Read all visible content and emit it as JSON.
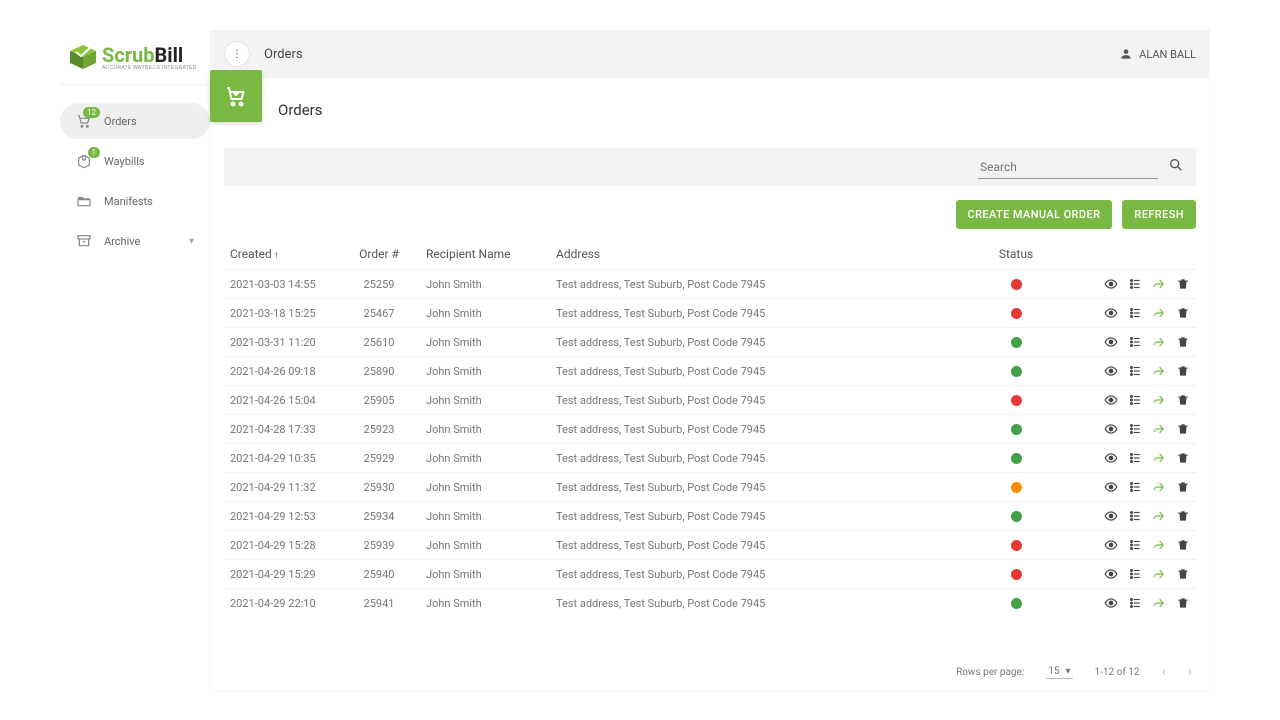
{
  "brand": {
    "name_a": "Scrub",
    "name_b": "Bill",
    "tagline": "ACCURATE WAYBILLS INTEGRATED"
  },
  "user": {
    "name": "ALAN BALL"
  },
  "crumb": "Orders",
  "nav": {
    "items": [
      {
        "label": "Orders",
        "badge": "12",
        "active": true
      },
      {
        "label": "Waybills",
        "badge": "1",
        "active": false
      },
      {
        "label": "Manifests",
        "badge": "",
        "active": false
      },
      {
        "label": "Archive",
        "badge": "",
        "active": false,
        "expandable": true
      }
    ]
  },
  "page": {
    "title": "Orders"
  },
  "search": {
    "placeholder": "Search"
  },
  "buttons": {
    "create": "CREATE MANUAL ORDER",
    "refresh": "REFRESH"
  },
  "columns": {
    "created": "Created",
    "order": "Order #",
    "recipient": "Recipient Name",
    "address": "Address",
    "status": "Status"
  },
  "rows": [
    {
      "created": "2021-03-03 14:55",
      "order": "25259",
      "name": "John Smith",
      "addr": "Test address, Test Suburb, Post Code 7945",
      "status": "red"
    },
    {
      "created": "2021-03-18 15:25",
      "order": "25467",
      "name": "John Smith",
      "addr": "Test address, Test Suburb, Post Code 7945",
      "status": "red"
    },
    {
      "created": "2021-03-31 11:20",
      "order": "25610",
      "name": "John Smith",
      "addr": "Test address, Test Suburb, Post Code 7945",
      "status": "green"
    },
    {
      "created": "2021-04-26 09:18",
      "order": "25890",
      "name": "John Smith",
      "addr": "Test address, Test Suburb, Post Code 7945",
      "status": "green"
    },
    {
      "created": "2021-04-26 15:04",
      "order": "25905",
      "name": "John Smith",
      "addr": "Test address, Test Suburb, Post Code 7945",
      "status": "red"
    },
    {
      "created": "2021-04-28 17:33",
      "order": "25923",
      "name": "John Smith",
      "addr": "Test address, Test Suburb, Post Code 7945",
      "status": "green"
    },
    {
      "created": "2021-04-29 10:35",
      "order": "25929",
      "name": "John Smith",
      "addr": "Test address, Test Suburb, Post Code 7945",
      "status": "green"
    },
    {
      "created": "2021-04-29 11:32",
      "order": "25930",
      "name": "John Smith",
      "addr": "Test address, Test Suburb, Post Code 7945",
      "status": "orange"
    },
    {
      "created": "2021-04-29 12:53",
      "order": "25934",
      "name": "John Smith",
      "addr": "Test address, Test Suburb, Post Code 7945",
      "status": "green"
    },
    {
      "created": "2021-04-29 15:28",
      "order": "25939",
      "name": "John Smith",
      "addr": "Test address, Test Suburb, Post Code 7945",
      "status": "red"
    },
    {
      "created": "2021-04-29 15:29",
      "order": "25940",
      "name": "John Smith",
      "addr": "Test address, Test Suburb, Post Code 7945",
      "status": "red"
    },
    {
      "created": "2021-04-29 22:10",
      "order": "25941",
      "name": "John Smith",
      "addr": "Test address, Test Suburb, Post Code 7945",
      "status": "green"
    }
  ],
  "pager": {
    "label": "Rows per page:",
    "size": "15",
    "range": "1-12 of 12"
  }
}
